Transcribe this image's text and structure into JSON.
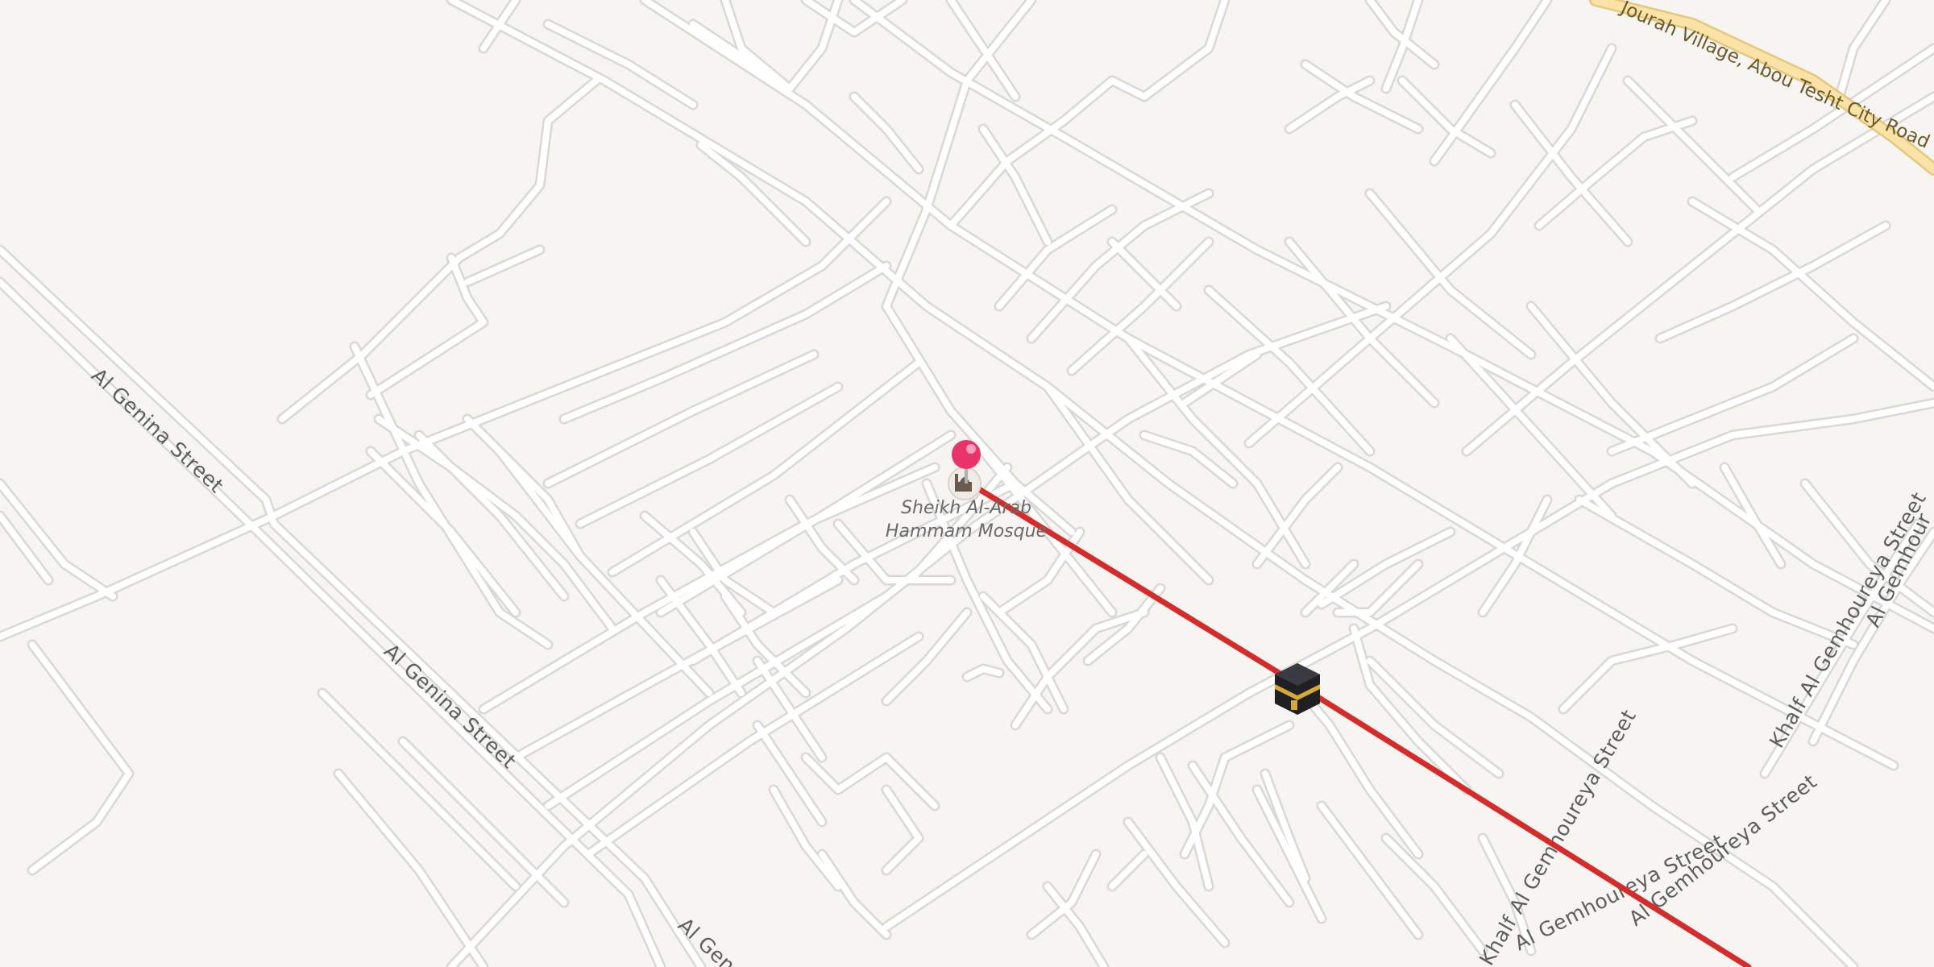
{
  "map": {
    "colors": {
      "background": "#f7f5f2",
      "road_casing": "#dad8d4",
      "road_fill": "#ffffff",
      "highway_fill": "#fbe3a8",
      "highway_casing": "#e6c77e",
      "route_line": "#d62b2b",
      "pin": "#e8336b"
    },
    "street_labels": {
      "al_genina_1": "Al Genina Street",
      "al_genina_2": "Al Genina Street",
      "al_genina_3": "Al Gen",
      "al_gemhoureya_1": "Al Gemhoureya Street",
      "al_gemhoureya_2": "Al Gemhoureya Street",
      "khalf_1": "Khalf Al Gemhoureya Street",
      "khalf_2": "Khalf Al Gemhoureya Street",
      "al_gemhour": "Al Gemhour",
      "highway": "Jourah Village, Abou Tesht City Road"
    },
    "poi": {
      "name_line1": "Sheikh Al-Arab",
      "name_line2": "Hammam Mosque",
      "icon": "mosque-icon"
    },
    "markers": {
      "origin": "pin-icon",
      "destination": "kaaba-icon"
    }
  }
}
